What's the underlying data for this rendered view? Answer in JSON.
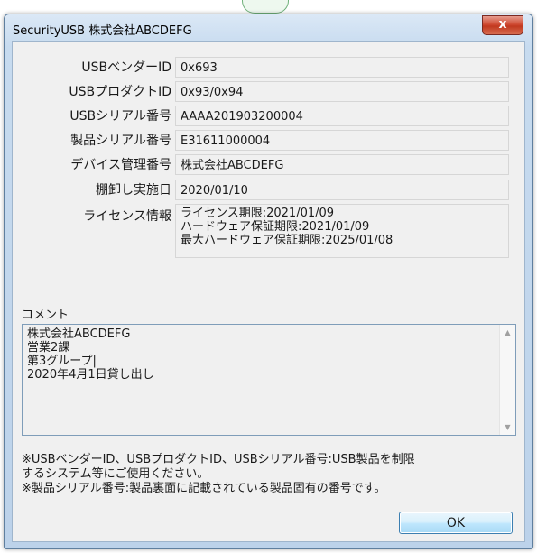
{
  "window": {
    "title": "SecurityUSB 株式会社ABCDEFG",
    "close_label": "x"
  },
  "fields": [
    {
      "label": "USBベンダーID",
      "value": "0x693"
    },
    {
      "label": "USBプロダクトID",
      "value": "0x93/0x94"
    },
    {
      "label": "USBシリアル番号",
      "value": "AAAA201903200004"
    },
    {
      "label": "製品シリアル番号",
      "value": "E31611000004"
    },
    {
      "label": "デバイス管理番号",
      "value": "株式会社ABCDEFG"
    },
    {
      "label": "棚卸し実施日",
      "value": "2020/01/10"
    }
  ],
  "license": {
    "label": "ライセンス情報",
    "lines": [
      "ライセンス期限:2021/01/09",
      "ハードウェア保証期限:2021/01/09",
      "最大ハードウェア保証期限:2025/01/08"
    ]
  },
  "comment": {
    "label": "コメント",
    "lines": [
      "株式会社ABCDEFG",
      "営業2課",
      "第3グループ|",
      "2020年4月1日貸し出し"
    ]
  },
  "notes": [
    "※USBベンダーID、USBプロダクトID、USBシリアル番号:USB製品を制限",
    "するシステム等にご使用ください。",
    "※製品シリアル番号:製品裏面に記載されている製品固有の番号です。"
  ],
  "ok_label": "OK"
}
